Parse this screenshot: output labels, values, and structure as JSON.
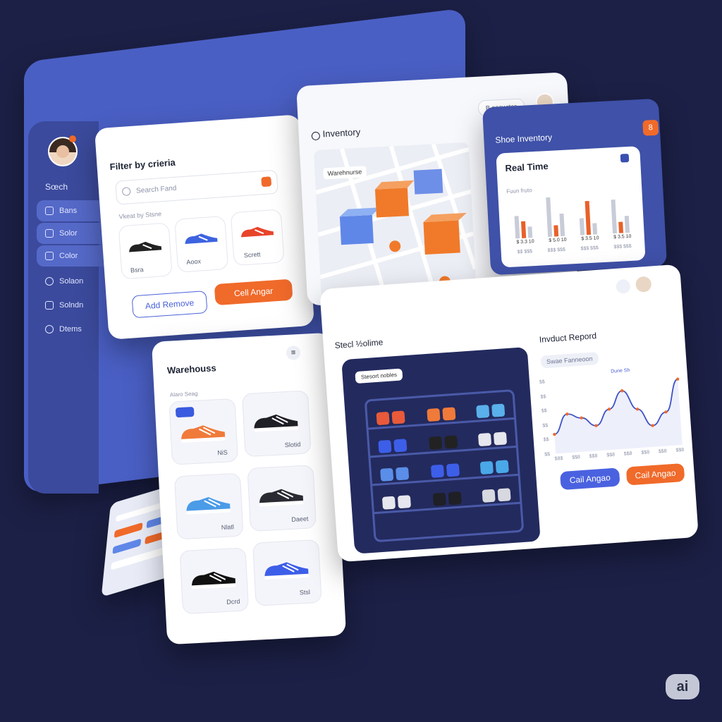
{
  "sidebar": {
    "search_label": "Sœch",
    "items": [
      {
        "label": "Bans",
        "icon": "tag-icon",
        "selected": true
      },
      {
        "label": "Solor",
        "icon": "box-icon",
        "selected": true
      },
      {
        "label": "Color",
        "icon": "palette-icon",
        "selected": true
      },
      {
        "label": "Solaon",
        "icon": "cloud-icon",
        "selected": false
      },
      {
        "label": "Solndn",
        "icon": "file-icon",
        "selected": false
      },
      {
        "label": "Dtems",
        "icon": "globe-icon",
        "selected": false
      }
    ]
  },
  "filter": {
    "title": "Filter by crieria",
    "search_placeholder": "Search Fand",
    "section_label": "Vkeat by Stsne",
    "shoes": [
      {
        "label": "Bsra",
        "color": "black"
      },
      {
        "label": "Aoox",
        "color": "blue"
      },
      {
        "label": "Scrett",
        "color": "red"
      }
    ],
    "add_remove_label": "Add Remove",
    "call_label": "Cell Angar"
  },
  "inventory": {
    "title": "Inventory",
    "top_pill": "B ooowrtcs",
    "map_label": "Warehnurse"
  },
  "shoe_inventory": {
    "title": "Shoe Inventory",
    "badge": "8",
    "real_time": "Real Time",
    "subtitle": "Fuun fruto",
    "value_labels": [
      "$ 3.3 10",
      "$ 5.0 10",
      "$ 3.5 10",
      "$ 3.5 10"
    ],
    "sub_labels": [
      "$$ $$$",
      "$$$ $$$",
      "$$$ $$$",
      "$$$ $$$"
    ]
  },
  "chart_data": {
    "type": "bar",
    "categories": [
      "$ 3.3 10",
      "$ 5.0 10",
      "$ 3.5 10",
      "$ 3.5 10"
    ],
    "series": [
      {
        "values": [
          4,
          7,
          3,
          6
        ]
      },
      {
        "values": [
          3,
          2,
          6,
          2
        ]
      },
      {
        "values": [
          2,
          4,
          2,
          3
        ]
      }
    ],
    "colors": [
      "#c8ccd8",
      "#e8612a",
      "#c8ccd8"
    ],
    "ylim": [
      0,
      8
    ]
  },
  "warehouse": {
    "title": "Warehouss",
    "subtitle": "Alaro Seag",
    "tiles": [
      {
        "label": "NiS",
        "color": "orange"
      },
      {
        "label": "Slotid",
        "color": "black"
      },
      {
        "label": "Nlatl",
        "color": "blue"
      },
      {
        "label": "Daeet",
        "color": "black"
      },
      {
        "label": "Dcrd",
        "color": "black"
      },
      {
        "label": "Stsl",
        "color": "blue"
      }
    ]
  },
  "stock": {
    "title": "Stecl ½olime",
    "badge": "Stesort nobles"
  },
  "report": {
    "title": "Invduct Repord",
    "pill": "Swae Fanneoon",
    "peak_label": "Dune Sh",
    "x_labels": [
      "$8$",
      "$$8",
      "$$8",
      "$$8",
      "$$8",
      "$$8",
      "$$8",
      "$$8"
    ],
    "y_labels": [
      "$$",
      "$$",
      "$$",
      "$$",
      "$$",
      "$$"
    ],
    "call_blue": "Cail Angao",
    "call_orange": "Cail Angao"
  },
  "line_chart_data": {
    "type": "line",
    "x": [
      0,
      1,
      2,
      3,
      4,
      5,
      6,
      7,
      8,
      9
    ],
    "y": [
      2,
      4,
      3.5,
      2.6,
      4.2,
      6,
      4,
      2.2,
      3.5,
      6.8
    ],
    "ylim": [
      0,
      8
    ]
  },
  "ai_badge": "ai"
}
